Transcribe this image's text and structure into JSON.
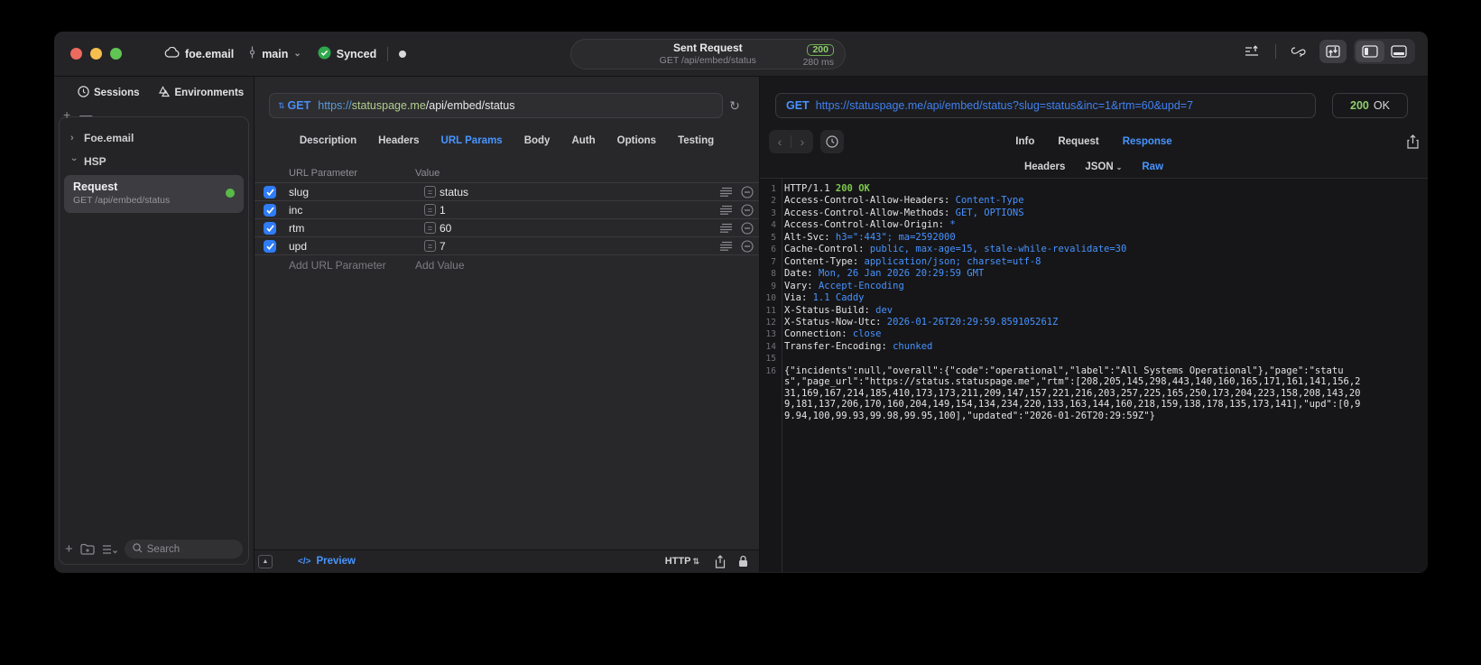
{
  "titlebar": {
    "project": "foe.email",
    "branch": "main",
    "sync_label": "Synced",
    "request_summary": {
      "title": "Sent Request",
      "subtitle": "GET /api/embed/status",
      "status_code": "200",
      "duration": "280 ms"
    }
  },
  "sidebar": {
    "tabs": [
      {
        "label": "Sessions",
        "icon": "clock-icon"
      },
      {
        "label": "Environments",
        "icon": "environments-icon"
      }
    ],
    "tree": [
      {
        "label": "Foe.email",
        "state": "collapsed"
      },
      {
        "label": "HSP",
        "state": "expanded"
      }
    ],
    "request_item": {
      "title": "Request",
      "subtitle": "GET /api/embed/status",
      "status_dot_color": "#58bb47"
    },
    "search_placeholder": "Search"
  },
  "editor": {
    "method": "GET",
    "url_scheme": "https://",
    "url_host": "statuspage.me",
    "url_path": "/api/embed/status",
    "tabs": [
      "Description",
      "Headers",
      "URL Params",
      "Body",
      "Auth",
      "Options",
      "Testing"
    ],
    "active_tab": "URL Params",
    "params": {
      "col_name": "URL Parameter",
      "col_value": "Value",
      "rows": [
        {
          "name": "slug",
          "value": "status",
          "enabled": true
        },
        {
          "name": "inc",
          "value": "1",
          "enabled": true
        },
        {
          "name": "rtm",
          "value": "60",
          "enabled": true
        },
        {
          "name": "upd",
          "value": "7",
          "enabled": true
        }
      ],
      "add_name_placeholder": "Add URL Parameter",
      "add_value_placeholder": "Add Value"
    },
    "footer": {
      "preview_label": "Preview",
      "mode_label": "HTTP"
    }
  },
  "response": {
    "method": "GET",
    "url": "https://statuspage.me/api/embed/status?slug=status&inc=1&rtm=60&upd=7",
    "status_code": "200",
    "status_text": "OK",
    "tabs": [
      "Info",
      "Request",
      "Response"
    ],
    "active_tab": "Response",
    "view_tabs": [
      "Headers",
      "JSON",
      "Raw"
    ],
    "active_view": "Raw",
    "dropdown_view": "JSON",
    "status_line": {
      "protocol": "HTTP/1.1",
      "status": "200 OK"
    },
    "headers": [
      {
        "key": "Access-Control-Allow-Headers",
        "value": "Content-Type"
      },
      {
        "key": "Access-Control-Allow-Methods",
        "value": "GET, OPTIONS"
      },
      {
        "key": "Access-Control-Allow-Origin",
        "value": "*"
      },
      {
        "key": "Alt-Svc",
        "value": "h3=\":443\"; ma=2592000"
      },
      {
        "key": "Cache-Control",
        "value": "public, max-age=15, stale-while-revalidate=30"
      },
      {
        "key": "Content-Type",
        "value": "application/json; charset=utf-8"
      },
      {
        "key": "Date",
        "value": "Mon, 26 Jan 2026 20:29:59 GMT"
      },
      {
        "key": "Vary",
        "value": "Accept-Encoding"
      },
      {
        "key": "Via",
        "value": "1.1 Caddy"
      },
      {
        "key": "X-Status-Build",
        "value": "dev"
      },
      {
        "key": "X-Status-Now-Utc",
        "value": "2026-01-26T20:29:59.859105261Z"
      },
      {
        "key": "Connection",
        "value": "close"
      },
      {
        "key": "Transfer-Encoding",
        "value": "chunked"
      }
    ],
    "body": "{\"incidents\":null,\"overall\":{\"code\":\"operational\",\"label\":\"All Systems Operational\"},\"page\":\"status\",\"page_url\":\"https://status.statuspage.me\",\"rtm\":[208,205,145,298,443,140,160,165,171,161,141,156,231,169,167,214,185,410,173,173,211,209,147,157,221,216,203,257,225,165,250,173,204,223,158,208,143,209,181,137,206,170,160,204,149,154,134,234,220,133,163,144,160,218,159,138,178,135,173,141],\"upd\":[0,99.94,100,99.93,99.98,99.95,100],\"updated\":\"2026-01-26T20:29:59Z\"}"
  },
  "colors": {
    "accent_blue": "#4795ff",
    "url_blue": "#4081f0",
    "status_green": "#8fcf6a",
    "checkbox_blue": "#2f7cf7",
    "traffic_red": "#ec6a5e",
    "traffic_yellow": "#f4bf4f",
    "traffic_green": "#61c454"
  }
}
